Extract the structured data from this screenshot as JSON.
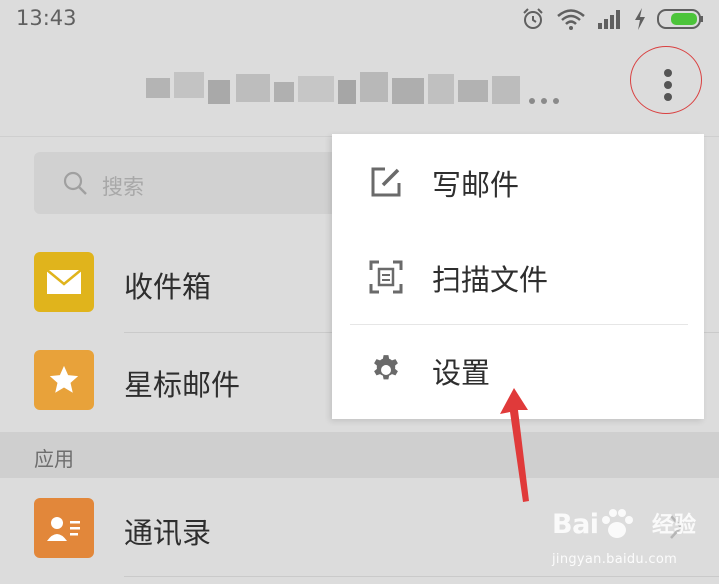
{
  "status_bar": {
    "time": "13:43"
  },
  "header": {
    "more_icon": "more-vertical-icon"
  },
  "search": {
    "placeholder": "搜索",
    "icon": "search-icon"
  },
  "folders": [
    {
      "label": "收件箱",
      "icon": "envelope-icon",
      "color": "#e0b41c"
    },
    {
      "label": "星标邮件",
      "icon": "star-icon",
      "color": "#e8a23a"
    }
  ],
  "section": {
    "label": "应用"
  },
  "apps": [
    {
      "label": "通讯录",
      "icon": "contact-card-icon",
      "color": "#e2873a"
    }
  ],
  "menu": {
    "items": [
      {
        "label": "写邮件",
        "icon": "compose-icon"
      },
      {
        "label": "扫描文件",
        "icon": "scan-icon"
      },
      {
        "label": "设置",
        "icon": "gear-icon"
      }
    ]
  },
  "watermark": {
    "logo": "Bai",
    "brand": "经验",
    "url": "jingyan.baidu.com"
  },
  "colors": {
    "annotation_red": "#d94040",
    "background": "#dcdcdc"
  }
}
